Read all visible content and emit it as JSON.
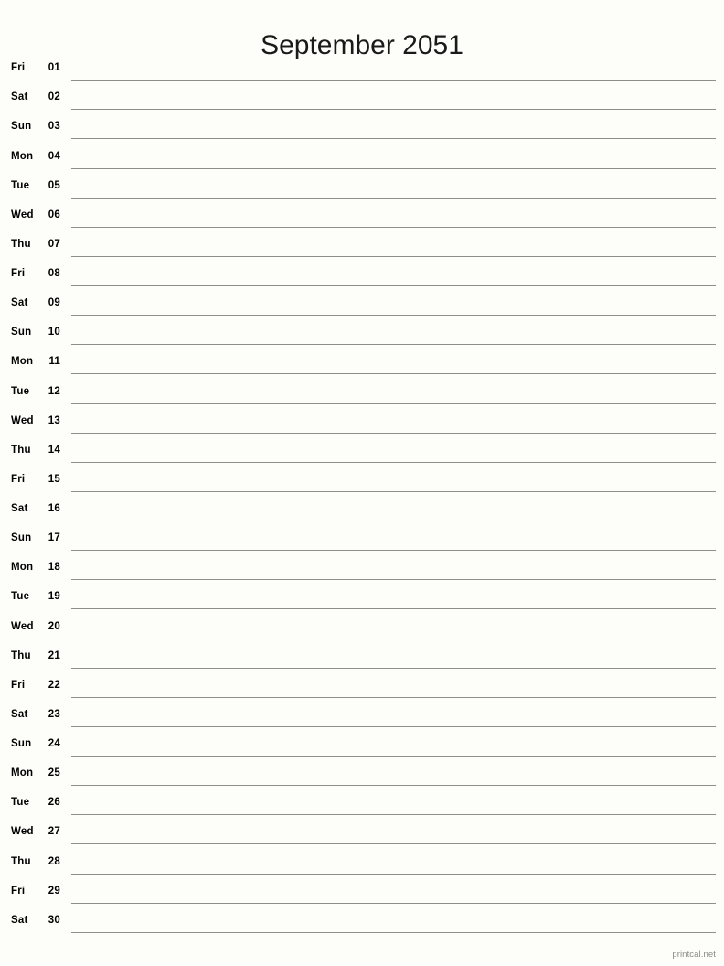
{
  "document": {
    "title": "September 2051",
    "month_name": "September",
    "year": "2051",
    "layout": "notes-list",
    "line_color": "#8d8f8a",
    "background_color": "#fdfdfa",
    "text_color": "#000000"
  },
  "footer": {
    "credit": "printcal.net",
    "color": "#8a8a86"
  },
  "days": [
    {
      "dow": "Fri",
      "num": "01"
    },
    {
      "dow": "Sat",
      "num": "02"
    },
    {
      "dow": "Sun",
      "num": "03"
    },
    {
      "dow": "Mon",
      "num": "04"
    },
    {
      "dow": "Tue",
      "num": "05"
    },
    {
      "dow": "Wed",
      "num": "06"
    },
    {
      "dow": "Thu",
      "num": "07"
    },
    {
      "dow": "Fri",
      "num": "08"
    },
    {
      "dow": "Sat",
      "num": "09"
    },
    {
      "dow": "Sun",
      "num": "10"
    },
    {
      "dow": "Mon",
      "num": "11"
    },
    {
      "dow": "Tue",
      "num": "12"
    },
    {
      "dow": "Wed",
      "num": "13"
    },
    {
      "dow": "Thu",
      "num": "14"
    },
    {
      "dow": "Fri",
      "num": "15"
    },
    {
      "dow": "Sat",
      "num": "16"
    },
    {
      "dow": "Sun",
      "num": "17"
    },
    {
      "dow": "Mon",
      "num": "18"
    },
    {
      "dow": "Tue",
      "num": "19"
    },
    {
      "dow": "Wed",
      "num": "20"
    },
    {
      "dow": "Thu",
      "num": "21"
    },
    {
      "dow": "Fri",
      "num": "22"
    },
    {
      "dow": "Sat",
      "num": "23"
    },
    {
      "dow": "Sun",
      "num": "24"
    },
    {
      "dow": "Mon",
      "num": "25"
    },
    {
      "dow": "Tue",
      "num": "26"
    },
    {
      "dow": "Wed",
      "num": "27"
    },
    {
      "dow": "Thu",
      "num": "28"
    },
    {
      "dow": "Fri",
      "num": "29"
    },
    {
      "dow": "Sat",
      "num": "30"
    }
  ]
}
